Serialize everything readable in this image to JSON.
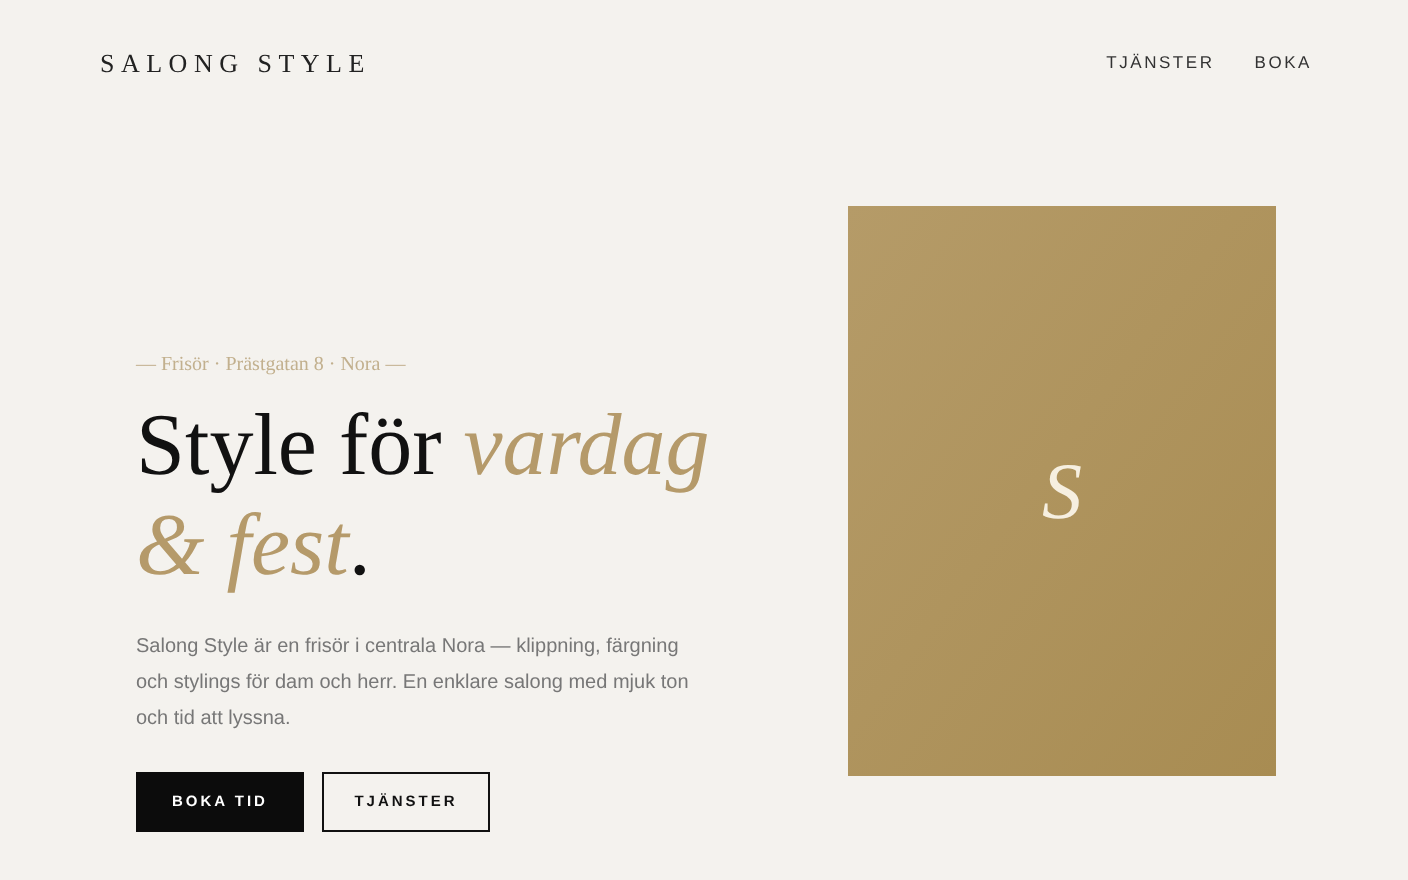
{
  "header": {
    "logo": "SALONG STYLE",
    "nav": [
      "TJÄNSTER",
      "BOKA"
    ]
  },
  "hero": {
    "eyebrow": "— Frisör · Prästgatan 8 · Nora —",
    "heading": [
      {
        "kind": "plain",
        "text": "Style för "
      },
      {
        "kind": "accent",
        "text": "vardag & fest"
      },
      {
        "kind": "plain",
        "text": "."
      }
    ],
    "description": "Salong Style är en frisör i centrala Nora — klippning, färgning och stylings för dam och herr. En enklare salong med mjuk ton och tid att lyssna.",
    "buttons": [
      {
        "kind": "primary",
        "label": "BOKA TID"
      },
      {
        "kind": "outline",
        "label": "TJÄNSTER"
      }
    ],
    "card": {
      "monogram": "S"
    }
  }
}
